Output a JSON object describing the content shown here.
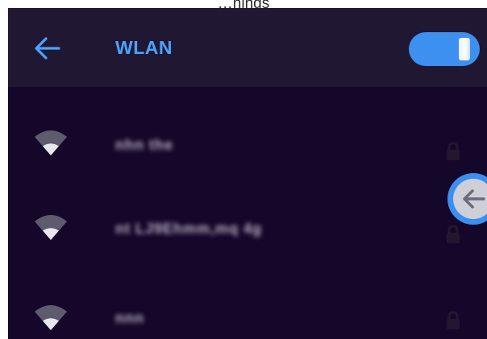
{
  "caption": "…nings",
  "header": {
    "back_icon": "arrow-left-icon",
    "title": "WLAN",
    "toggle_state": "on"
  },
  "networks": [
    {
      "ssid": "nhn the",
      "signal_icon": "wifi-icon",
      "secured": true
    },
    {
      "ssid": "nt LJ9Ehmm,mq 4g",
      "signal_icon": "wifi-icon",
      "secured": true
    },
    {
      "ssid": "nnn",
      "signal_icon": "wifi-icon",
      "secured": true
    }
  ],
  "floating_button": {
    "icon": "arrow-left-icon"
  },
  "colors": {
    "background": "#15072a",
    "header": "#201733",
    "accent": "#4ba3ff",
    "toggle": "#3d8ff0"
  }
}
